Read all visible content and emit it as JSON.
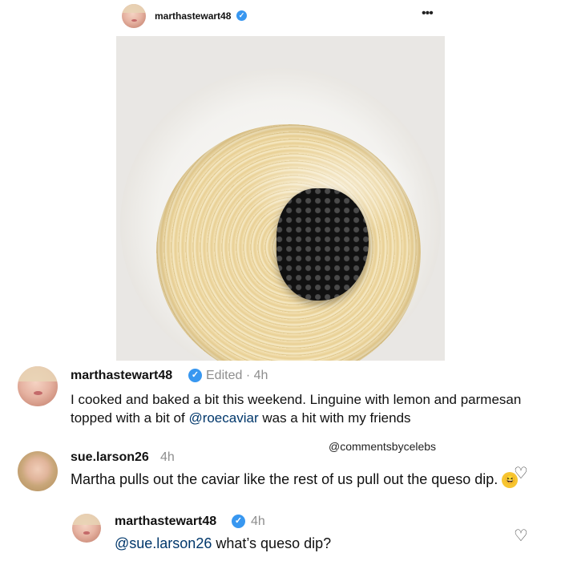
{
  "post": {
    "username": "marthastewart48",
    "more_icon": "more-horizontal-icon"
  },
  "comments": [
    {
      "username": "marthastewart48",
      "meta": "Edited · 4h",
      "text_before": "I cooked and baked a bit this weekend. Linguine with lemon and parmesan  topped with a bit of ",
      "mention": "@roecaviar",
      "text_after": " was a hit with my friends"
    },
    {
      "username": "sue.larson26",
      "meta": "4h",
      "text": "Martha pulls out the caviar like the rest of us pull out the queso dip. ",
      "emoji": "😆"
    },
    {
      "username": "marthastewart48",
      "meta": "4h",
      "mention": "@sue.larson26",
      "text": " what’s queso dip?"
    }
  ],
  "watermark": "@commentsbycelebs",
  "colors": {
    "verified": "#3897f0",
    "mention": "#00376b",
    "meta": "#8e8e8e"
  }
}
